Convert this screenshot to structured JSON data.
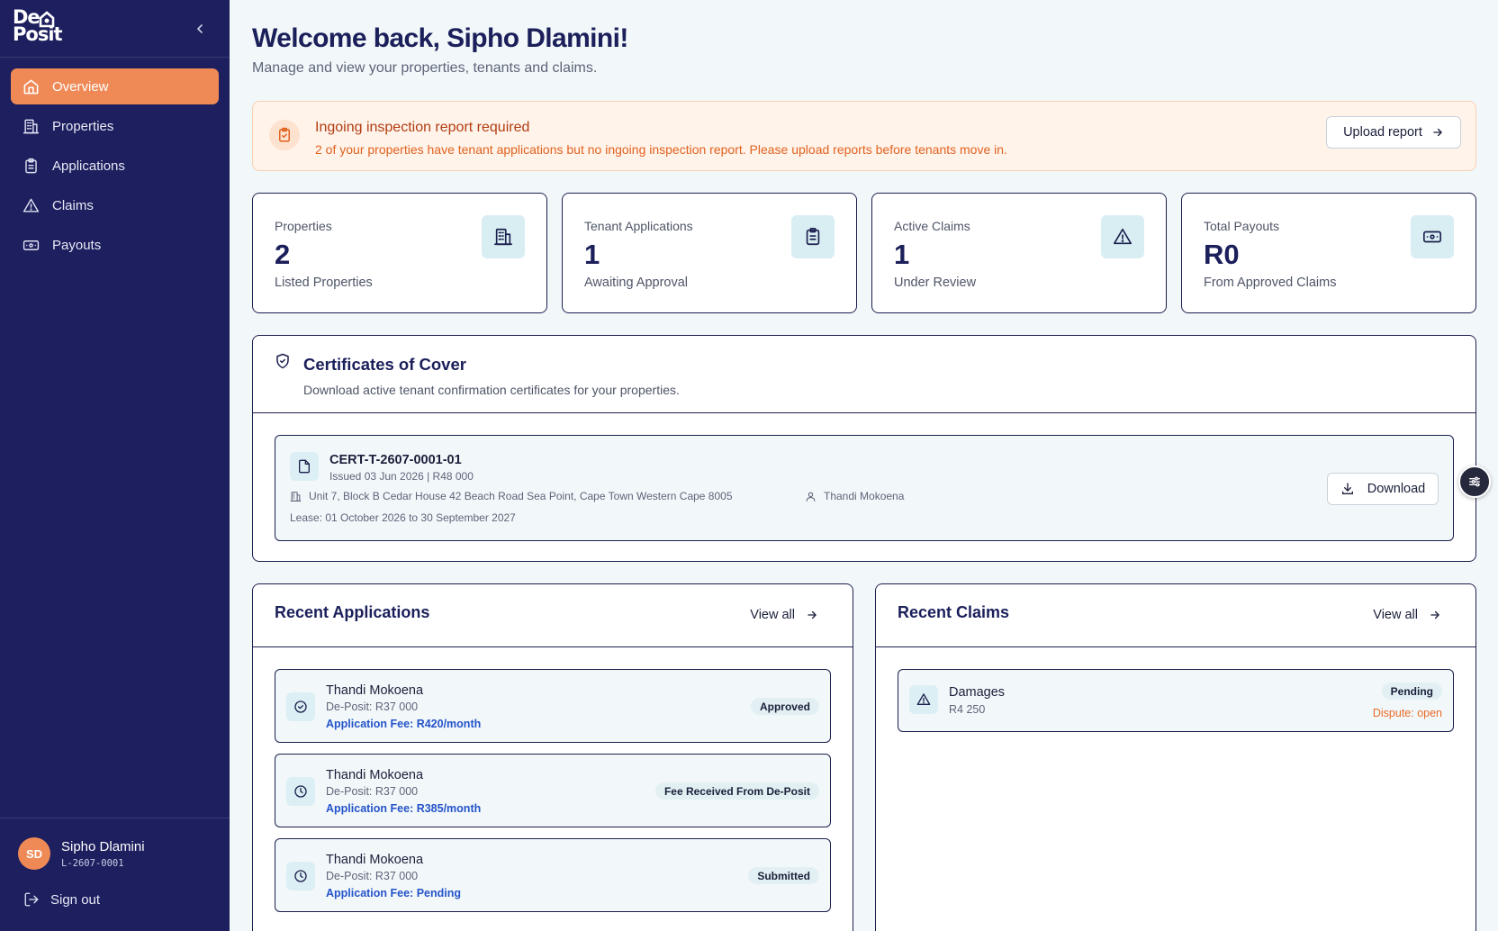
{
  "sidebar": {
    "logo_line1": "De",
    "logo_line2": "Posit",
    "nav": [
      {
        "label": "Overview",
        "icon": "home-icon",
        "active": true
      },
      {
        "label": "Properties",
        "icon": "building-icon"
      },
      {
        "label": "Applications",
        "icon": "clipboard-icon"
      },
      {
        "label": "Claims",
        "icon": "warning-icon"
      },
      {
        "label": "Payouts",
        "icon": "banknote-icon"
      }
    ],
    "user": {
      "initials": "SD",
      "name": "Sipho Dlamini",
      "id": "L-2607-0001"
    },
    "signout": "Sign out"
  },
  "header": {
    "title": "Welcome back, Sipho Dlamini!",
    "subtitle": "Manage and view your properties, tenants and claims."
  },
  "alert": {
    "title": "Ingoing inspection report required",
    "text": "2 of your properties have tenant applications but no ingoing inspection report. Please upload reports before tenants move in.",
    "button": "Upload report"
  },
  "stats": [
    {
      "label": "Properties",
      "value": "2",
      "sub": "Listed Properties",
      "icon": "building-icon"
    },
    {
      "label": "Tenant Applications",
      "value": "1",
      "sub": "Awaiting Approval",
      "icon": "clipboard-icon"
    },
    {
      "label": "Active Claims",
      "value": "1",
      "sub": "Under Review",
      "icon": "warning-icon"
    },
    {
      "label": "Total Payouts",
      "value": "R0",
      "sub": "From Approved Claims",
      "icon": "banknote-icon"
    }
  ],
  "certificates": {
    "title": "Certificates of Cover",
    "description": "Download active tenant confirmation certificates for your properties.",
    "items": [
      {
        "id": "CERT-T-2607-0001-01",
        "issued": "Issued 03 Jun 2026 | R48 000",
        "address": "Unit 7, Block B Cedar House 42 Beach Road Sea Point, Cape Town Western Cape 8005",
        "tenant": "Thandi Mokoena",
        "lease": "Lease: 01 October 2026 to 30 September 2027",
        "button": "Download"
      }
    ]
  },
  "recent_applications": {
    "title": "Recent Applications",
    "view_all": "View all",
    "items": [
      {
        "name": "Thandi Mokoena",
        "deposit": "De-Posit: R37 000",
        "fee": "Application Fee: R420/month",
        "status": "Approved",
        "icon": "check-circle-icon"
      },
      {
        "name": "Thandi Mokoena",
        "deposit": "De-Posit: R37 000",
        "fee": "Application Fee: R385/month",
        "status": "Fee Received From De-Posit",
        "icon": "clock-icon"
      },
      {
        "name": "Thandi Mokoena",
        "deposit": "De-Posit: R37 000",
        "fee": "Application Fee: Pending",
        "status": "Submitted",
        "icon": "clock-icon"
      }
    ]
  },
  "recent_claims": {
    "title": "Recent Claims",
    "view_all": "View all",
    "items": [
      {
        "type": "Damages",
        "amount": "R4 250",
        "status": "Pending",
        "dispute": "Dispute: open",
        "icon": "warning-icon"
      }
    ]
  },
  "colors": {
    "sidebar": "#1d1f5e",
    "accent": "#ef8a57",
    "link": "#2553c9",
    "alert_bg": "#fff3ea"
  }
}
